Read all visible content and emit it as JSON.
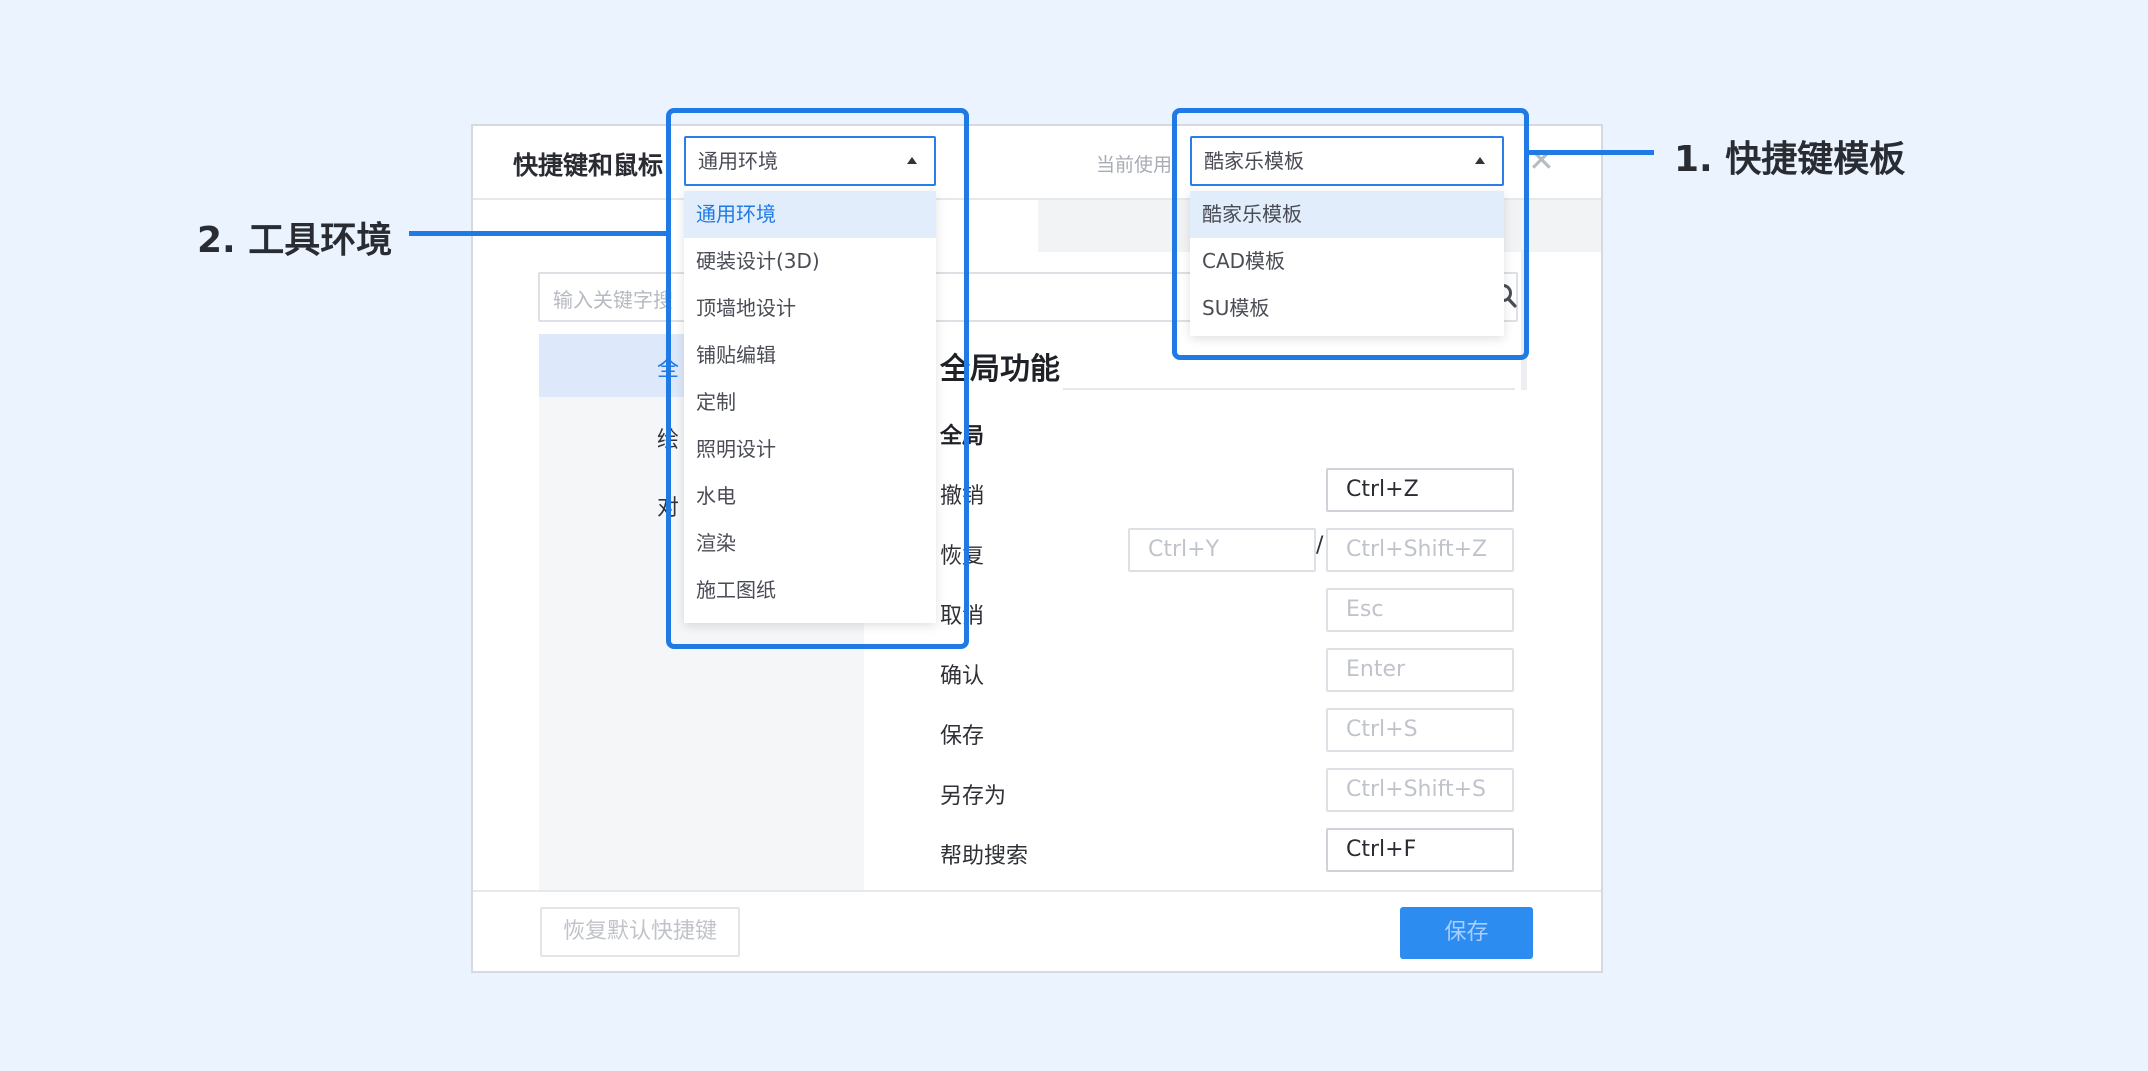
{
  "dialog": {
    "title": "快捷键和鼠标",
    "current_use_label": "当前使用",
    "close_glyph": "✕",
    "search_placeholder": "输入关键字搜",
    "sidebar": [
      "全局功能",
      "绘制",
      "对象"
    ],
    "sidebar_visible": [
      "全",
      "绘",
      "对"
    ],
    "section_title": "全局功能",
    "group_label": "全局",
    "shortcuts": [
      {
        "label": "撤销",
        "key": "Ctrl+Z"
      },
      {
        "label": "恢复",
        "alt_key": "Ctrl+Y",
        "key": "Ctrl+Shift+Z"
      },
      {
        "label": "取消",
        "key": "Esc"
      },
      {
        "label": "确认",
        "key": "Enter"
      },
      {
        "label": "保存",
        "key": "Ctrl+S"
      },
      {
        "label": "另存为",
        "key": "Ctrl+Shift+S"
      },
      {
        "label": "帮助搜索",
        "key": "Ctrl+F"
      }
    ],
    "slash": "/",
    "reset_button": "恢复默认快捷键",
    "save_button": "保存"
  },
  "env_dropdown": {
    "selected": "通用环境",
    "options": [
      "通用环境",
      "硬装设计(3D)",
      "顶墙地设计",
      "铺贴编辑",
      "定制",
      "照明设计",
      "水电",
      "渲染",
      "施工图纸"
    ]
  },
  "template_dropdown": {
    "selected": "酷家乐模板",
    "options": [
      "酷家乐模板",
      "CAD模板",
      "SU模板"
    ]
  },
  "callouts": {
    "template": "1. 快捷键模板",
    "environment": "2. 工具环境"
  },
  "colors": {
    "background": "#ebf4fe",
    "accent": "#1f7ae6",
    "save_button": "#2d8cf0"
  }
}
